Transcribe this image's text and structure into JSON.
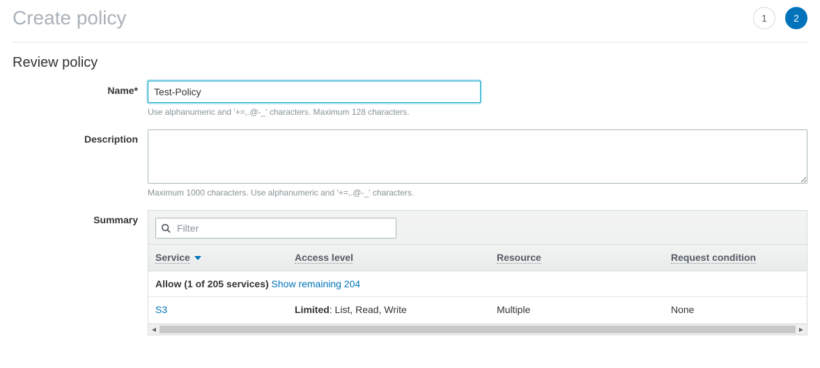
{
  "header": {
    "title": "Create policy",
    "steps": [
      "1",
      "2"
    ],
    "active_step_index": 1
  },
  "review": {
    "section_title": "Review policy",
    "name": {
      "label": "Name*",
      "value": "Test-Policy",
      "help": "Use alphanumeric and '+=,.@-_' characters. Maximum 128 characters."
    },
    "description": {
      "label": "Description",
      "value": "",
      "help": "Maximum 1000 characters. Use alphanumeric and '+=,.@-_' characters."
    },
    "summary": {
      "label": "Summary",
      "filter_placeholder": "Filter",
      "columns": {
        "service": "Service",
        "access": "Access level",
        "resource": "Resource",
        "request": "Request condition"
      },
      "allow_group": {
        "prefix": "Allow ",
        "count_text": "(1 of 205 services)",
        "show_link": "Show remaining 204"
      },
      "rows": [
        {
          "service": "S3",
          "access_prefix": "Limited",
          "access_detail": ": List, Read, Write",
          "resource": "Multiple",
          "request": "None"
        }
      ]
    }
  }
}
